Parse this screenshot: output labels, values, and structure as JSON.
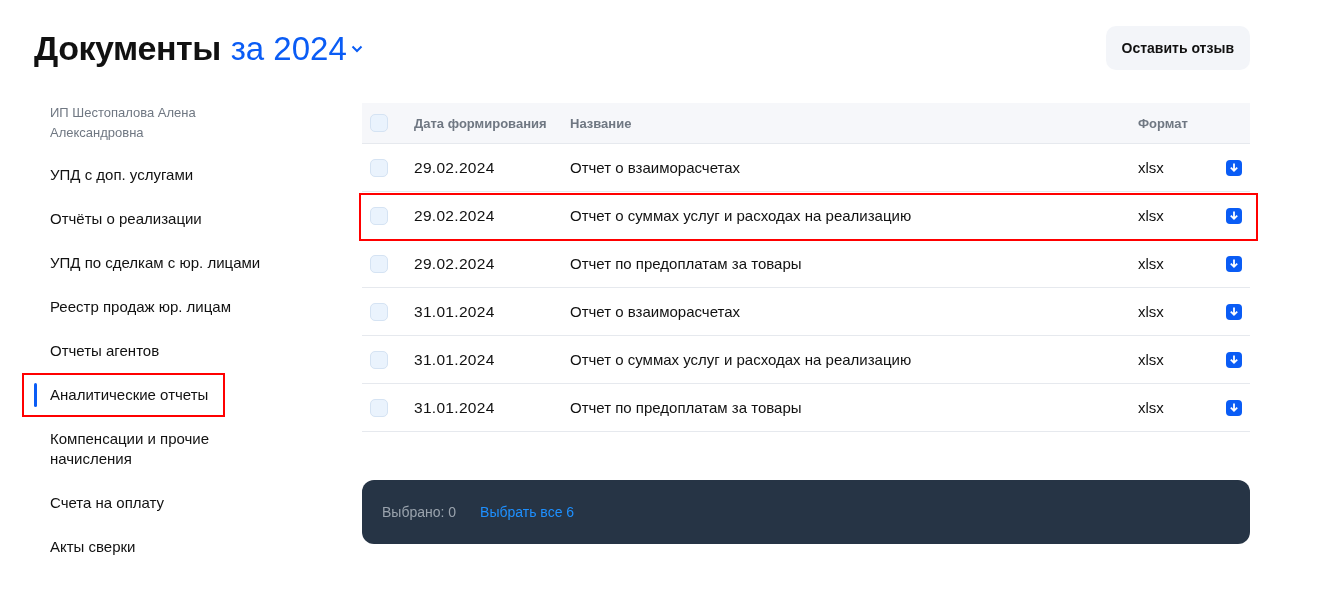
{
  "header": {
    "title": "Документы",
    "period": "за 2024",
    "feedback_button": "Оставить отзыв"
  },
  "sidebar": {
    "owner": "ИП Шестопалова Алена Александровна",
    "items": [
      {
        "label": "УПД с доп. услугами",
        "selected": false,
        "highlighted": false
      },
      {
        "label": "Отчёты о реализации",
        "selected": false,
        "highlighted": false
      },
      {
        "label": "УПД по сделкам с юр. лицами",
        "selected": false,
        "highlighted": false
      },
      {
        "label": "Реестр продаж юр. лицам",
        "selected": false,
        "highlighted": false
      },
      {
        "label": "Отчеты агентов",
        "selected": false,
        "highlighted": false
      },
      {
        "label": "Аналитические отчеты",
        "selected": true,
        "highlighted": true
      },
      {
        "label": "Компенсации и прочие начисления",
        "selected": false,
        "highlighted": false
      },
      {
        "label": "Счета на оплату",
        "selected": false,
        "highlighted": false
      },
      {
        "label": "Акты сверки",
        "selected": false,
        "highlighted": false
      }
    ]
  },
  "table": {
    "select_all_checked": false,
    "columns": [
      "Дата формирования",
      "Название",
      "Формат"
    ],
    "rows": [
      {
        "date": "29.02.2024",
        "name": "Отчет о взаиморасчетах",
        "format": "xlsx",
        "checked": false,
        "highlighted": false
      },
      {
        "date": "29.02.2024",
        "name": "Отчет о суммах услуг и расходах на реализацию",
        "format": "xlsx",
        "checked": false,
        "highlighted": true
      },
      {
        "date": "29.02.2024",
        "name": "Отчет по предоплатам за товары",
        "format": "xlsx",
        "checked": false,
        "highlighted": false
      },
      {
        "date": "31.01.2024",
        "name": "Отчет о взаиморасчетах",
        "format": "xlsx",
        "checked": false,
        "highlighted": false
      },
      {
        "date": "31.01.2024",
        "name": "Отчет о суммах услуг и расходах на реализацию",
        "format": "xlsx",
        "checked": false,
        "highlighted": false
      },
      {
        "date": "31.01.2024",
        "name": "Отчет по предоплатам за товары",
        "format": "xlsx",
        "checked": false,
        "highlighted": false
      }
    ]
  },
  "selection_bar": {
    "selected_count": "Выбрано: 0",
    "select_all_link": "Выбрать все 6"
  }
}
